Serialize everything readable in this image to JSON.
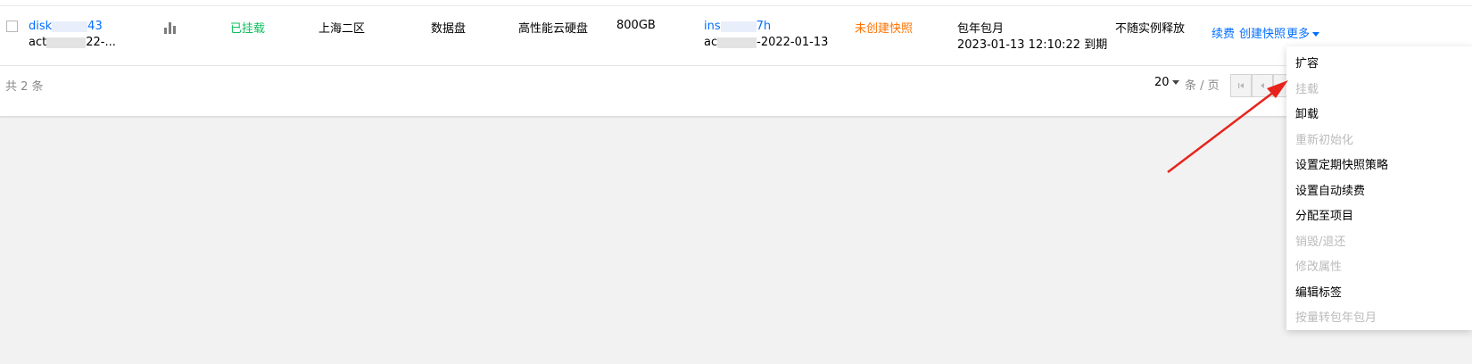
{
  "table": {
    "row": {
      "id_prefix": "disk",
      "id_suffix": "43",
      "id_sub_prefix": "act",
      "id_sub_suffix": "22-...",
      "status": "已挂载",
      "region": "上海二区",
      "disk_type": "数据盘",
      "media": "高性能云硬盘",
      "capacity": "800GB",
      "instance_prefix": "ins",
      "instance_suffix": "7h",
      "instance_sub_prefix": "ac",
      "instance_sub_suffix": "-2022-01-13",
      "snapshot": "未创建快照",
      "billing": "包年包月",
      "expire": "2023-01-13 12:10:22 到期",
      "release": "不随实例释放",
      "actions": {
        "renew": "续费",
        "create_snapshot": "创建快照",
        "more": "更多"
      }
    }
  },
  "footer": {
    "total": "共 2 条",
    "page_size": "20",
    "page_size_unit": "条 / 页"
  },
  "more_menu": {
    "items": [
      {
        "label": "扩容",
        "disabled": false
      },
      {
        "label": "挂载",
        "disabled": true
      },
      {
        "label": "卸载",
        "disabled": false
      },
      {
        "label": "重新初始化",
        "disabled": true
      },
      {
        "label": "设置定期快照策略",
        "disabled": false
      },
      {
        "label": "设置自动续费",
        "disabled": false
      },
      {
        "label": "分配至项目",
        "disabled": false
      },
      {
        "label": "销毁/退还",
        "disabled": true
      },
      {
        "label": "修改属性",
        "disabled": true
      },
      {
        "label": "编辑标签",
        "disabled": false
      },
      {
        "label": "按量转包年包月",
        "disabled": true
      }
    ]
  },
  "colors": {
    "link": "#006eff",
    "status_ok": "#0abf5b",
    "warning": "#ff7200",
    "annotation_arrow": "#e8231b"
  }
}
